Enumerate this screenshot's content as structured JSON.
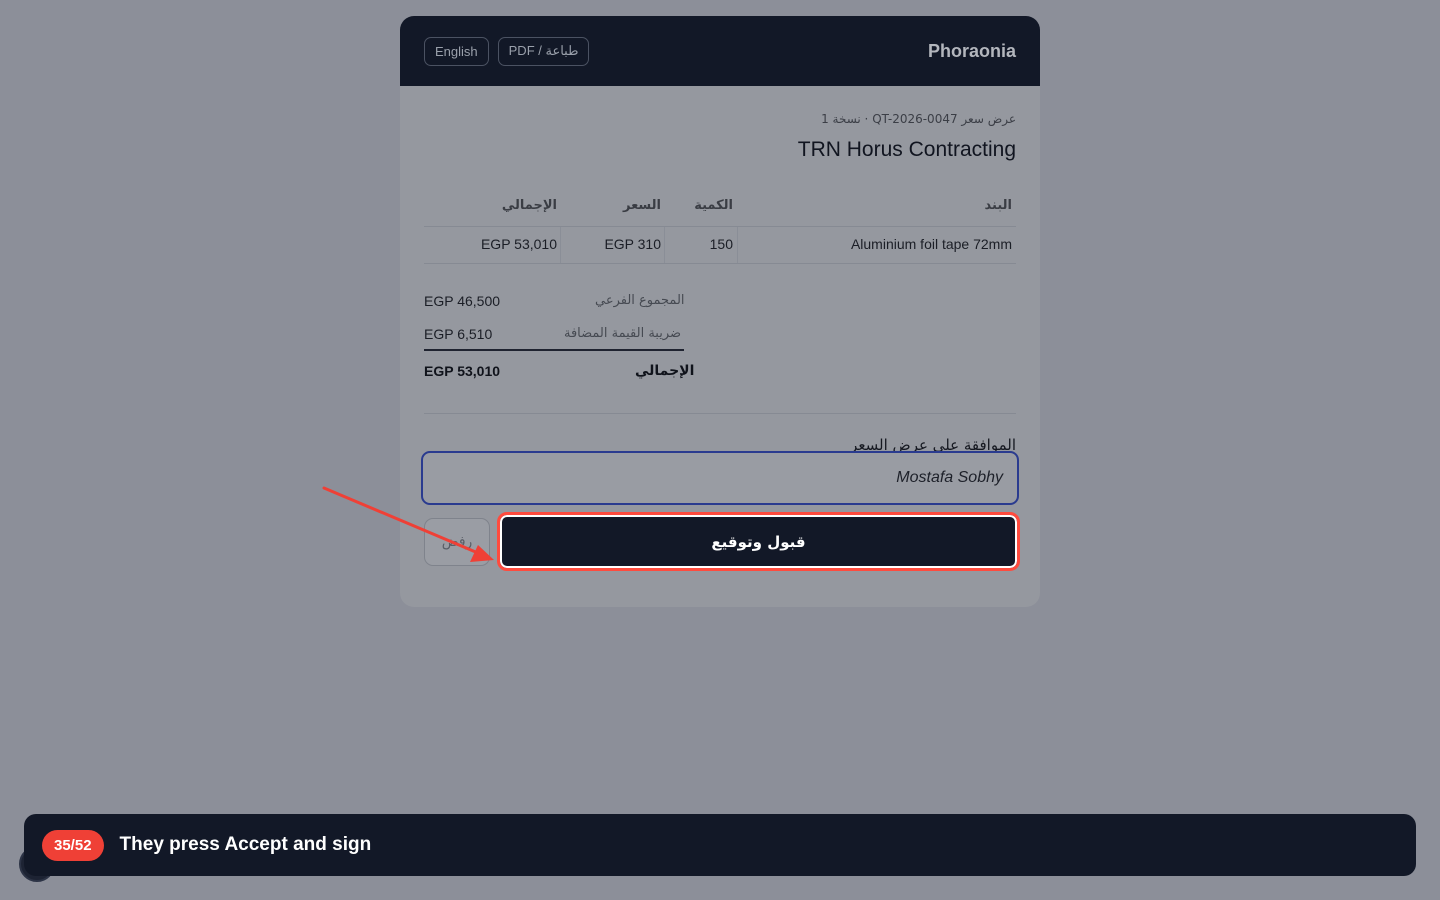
{
  "header": {
    "brand": "Phoraonia",
    "print_label": "PDF / طباعة",
    "language_label": "English"
  },
  "quote": {
    "meta": "عرض سعر QT-2026-0047 · نسخة 1",
    "client": "TRN Horus Contracting"
  },
  "table": {
    "headers": {
      "item": "البند",
      "qty": "الكمية",
      "price": "السعر",
      "total": "الإجمالي"
    },
    "rows": [
      {
        "item": "Aluminium foil tape 72mm",
        "qty": "150",
        "price": "EGP 310",
        "total": "EGP 53,010"
      }
    ]
  },
  "summary": {
    "subtotal_label": "المجموع الفرعي",
    "subtotal_value": "EGP 46,500",
    "vat_label": "ضريبة القيمة المضافة",
    "vat_value": "EGP 6,510",
    "total_label": "الإجمالي",
    "total_value": "EGP 53,010"
  },
  "approval": {
    "label": "الموافقة على عرض السعر",
    "signature_value": "Mostafa Sobhy",
    "accept_label": "قبول وتوقيع",
    "reject_label": "رفض"
  },
  "tutorial": {
    "step": "35/52",
    "caption": "They press Accept and sign"
  },
  "colors": {
    "highlight": "#ff4b3e",
    "primary": "#121827"
  }
}
